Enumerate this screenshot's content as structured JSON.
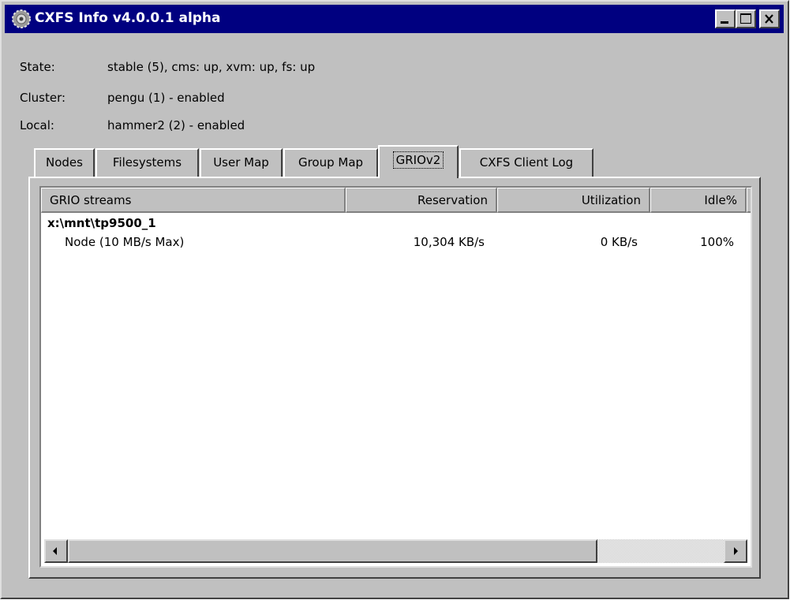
{
  "window": {
    "title": "CXFS Info v4.0.0.1 alpha",
    "icon": "cxfs-gear-icon",
    "controls": [
      "minimize-icon",
      "maximize-icon",
      "close-icon"
    ]
  },
  "info": {
    "state_label": "State:",
    "state_value": "stable (5), cms: up, xvm: up, fs: up",
    "cluster_label": "Cluster:",
    "cluster_value": "pengu (1) - enabled",
    "local_label": "Local:",
    "local_value": "hammer2 (2) - enabled"
  },
  "tabs": [
    {
      "label": "Nodes"
    },
    {
      "label": "Filesystems"
    },
    {
      "label": "User Map"
    },
    {
      "label": "Group Map"
    },
    {
      "label": "GRIOv2",
      "active": true
    },
    {
      "label": "CXFS Client Log"
    }
  ],
  "table": {
    "columns": [
      "GRIO streams",
      "Reservation",
      "Utilization",
      "Idle%"
    ],
    "group": "x:\\mnt\\tp9500_1",
    "rows": [
      {
        "stream": "Node (10 MB/s Max)",
        "reservation": "10,304 KB/s",
        "utilization": "0 KB/s",
        "idle": "100%"
      }
    ]
  },
  "scrollbar": {
    "left_icon": "scroll-left-arrow-icon",
    "right_icon": "scroll-right-arrow-icon"
  },
  "colors": {
    "titlebar": "#000080",
    "face": "#c0c0c0"
  }
}
